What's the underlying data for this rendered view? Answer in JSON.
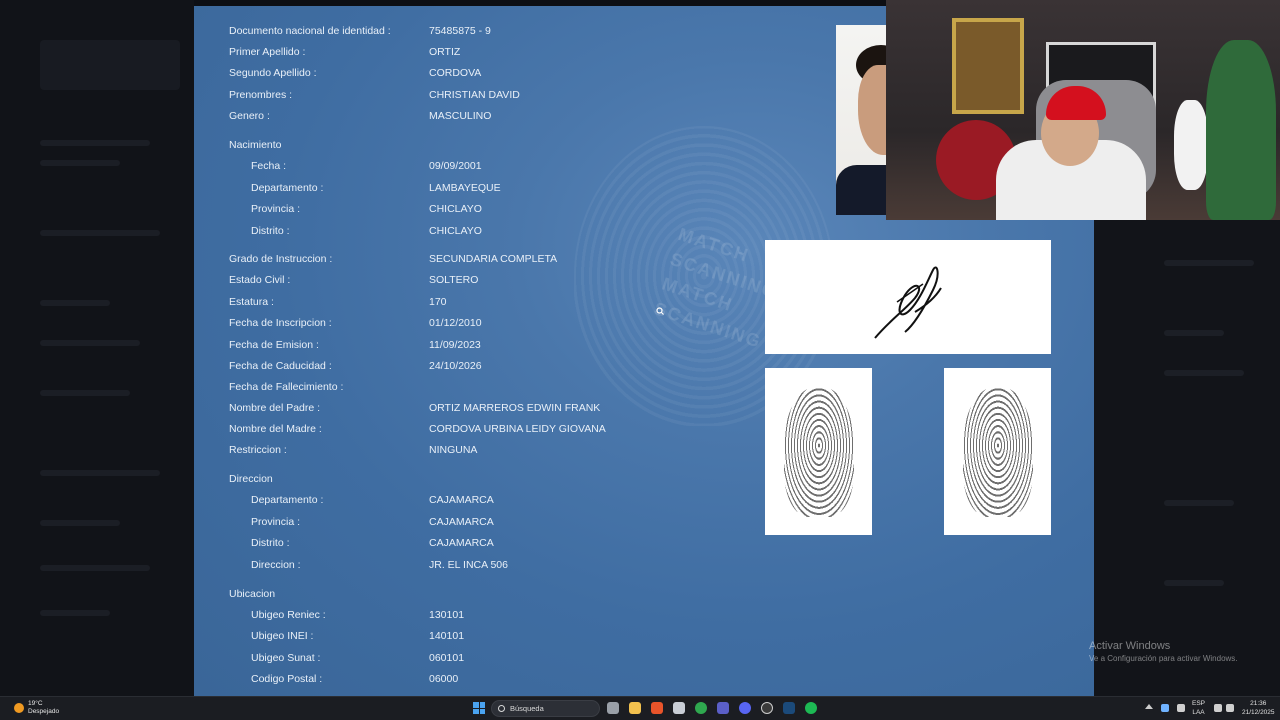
{
  "document": {
    "rows": [
      {
        "label": "Documento nacional de identidad :",
        "value": "75485875 - 9"
      },
      {
        "label": "Primer Apellido :",
        "value": "ORTIZ"
      },
      {
        "label": "Segundo Apellido :",
        "value": "CORDOVA"
      },
      {
        "label": "Prenombres :",
        "value": "CHRISTIAN DAVID"
      },
      {
        "label": "Genero :",
        "value": "MASCULINO"
      }
    ],
    "nacimiento": {
      "title": "Nacimiento",
      "rows": [
        {
          "label": "Fecha :",
          "value": "09/09/2001"
        },
        {
          "label": "Departamento :",
          "value": "LAMBAYEQUE"
        },
        {
          "label": "Provincia :",
          "value": "CHICLAYO"
        },
        {
          "label": "Distrito :",
          "value": "CHICLAYO"
        }
      ]
    },
    "rows2": [
      {
        "label": "Grado de Instruccion :",
        "value": "SECUNDARIA COMPLETA"
      },
      {
        "label": "Estado Civil :",
        "value": "SOLTERO"
      },
      {
        "label": "Estatura :",
        "value": "170"
      },
      {
        "label": "Fecha de Inscripcion :",
        "value": "01/12/2010"
      },
      {
        "label": "Fecha de Emision :",
        "value": "11/09/2023"
      },
      {
        "label": "Fecha de Caducidad :",
        "value": "24/10/2026"
      },
      {
        "label": "Fecha de Fallecimiento :",
        "value": ""
      },
      {
        "label": "Nombre del Padre :",
        "value": "ORTIZ MARREROS EDWIN FRANK"
      },
      {
        "label": "Nombre del Madre :",
        "value": "CORDOVA URBINA LEIDY GIOVANA"
      },
      {
        "label": "Restriccion :",
        "value": "NINGUNA"
      }
    ],
    "direccion": {
      "title": "Direccion",
      "rows": [
        {
          "label": "Departamento :",
          "value": "CAJAMARCA"
        },
        {
          "label": "Provincia :",
          "value": "CAJAMARCA"
        },
        {
          "label": "Distrito :",
          "value": "CAJAMARCA"
        },
        {
          "label": "Direccion :",
          "value": "JR. EL INCA 506"
        }
      ]
    },
    "ubicacion": {
      "title": "Ubicacion",
      "rows": [
        {
          "label": "Ubigeo Reniec :",
          "value": "130101"
        },
        {
          "label": "Ubigeo INEI :",
          "value": "140101"
        },
        {
          "label": "Ubigeo Sunat :",
          "value": "060101"
        },
        {
          "label": "Codigo Postal :",
          "value": "06000"
        }
      ]
    },
    "watermark_text": [
      "MATCH",
      "SCANNING",
      "MATCH",
      "SCANNING"
    ]
  },
  "activation": {
    "title": "Activar Windows",
    "subtitle": "Ve a Configuración para activar Windows."
  },
  "taskbar": {
    "weather_temp": "19°C",
    "weather_desc": "Despejado",
    "search_placeholder": "Búsqueda",
    "lang_top": "ESP",
    "lang_bottom": "LAA",
    "time": "21:36",
    "date": "21/12/2025",
    "pinned_icons": [
      "task-view-icon",
      "file-explorer-icon",
      "brave-icon",
      "store-icon",
      "chrome-icon",
      "teams-icon",
      "discord-icon",
      "obs-icon",
      "steam-icon",
      "spotify-icon"
    ],
    "colors": {
      "accent": "#4aa3f0",
      "panel": "#3f6da2"
    }
  }
}
